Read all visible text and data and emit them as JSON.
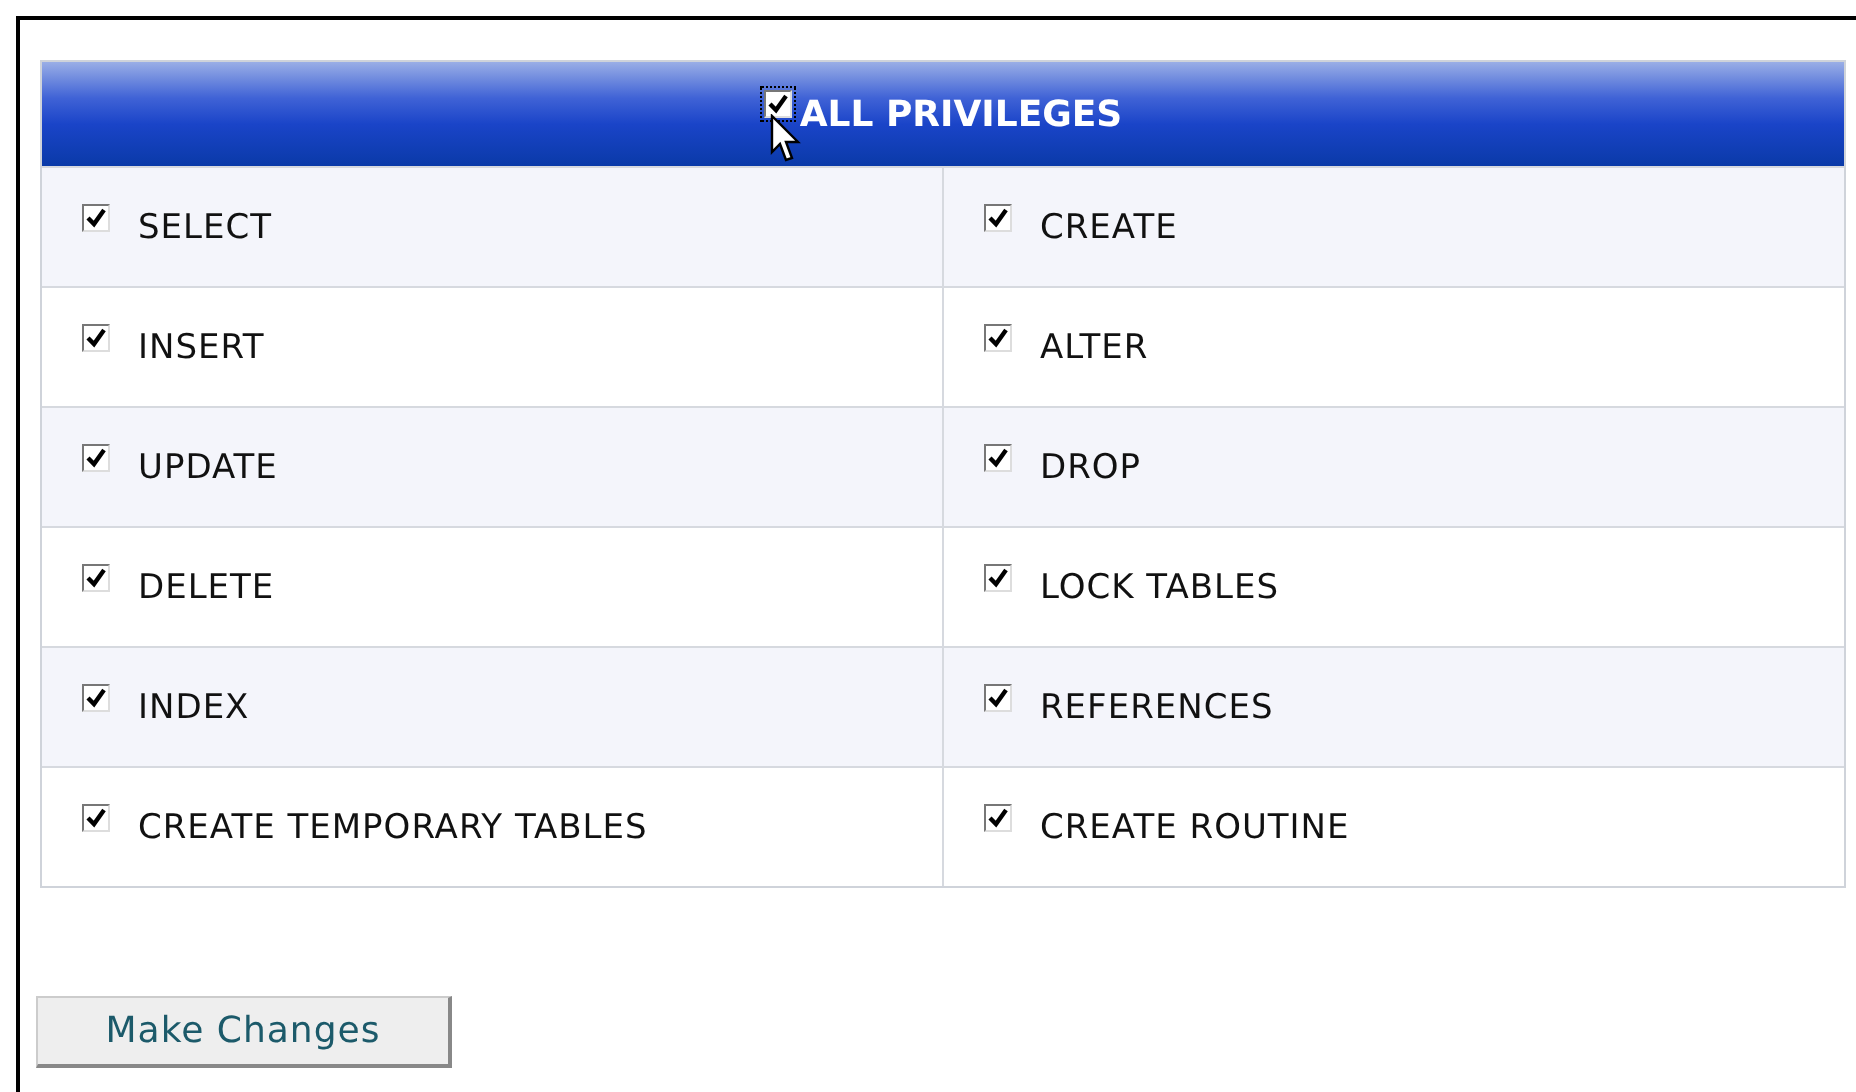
{
  "header": {
    "label": "ALL PRIVILEGES",
    "checked": true
  },
  "rows": [
    [
      {
        "label": "SELECT",
        "checked": true
      },
      {
        "label": "CREATE",
        "checked": true
      }
    ],
    [
      {
        "label": "INSERT",
        "checked": true
      },
      {
        "label": "ALTER",
        "checked": true
      }
    ],
    [
      {
        "label": "UPDATE",
        "checked": true
      },
      {
        "label": "DROP",
        "checked": true
      }
    ],
    [
      {
        "label": "DELETE",
        "checked": true
      },
      {
        "label": "LOCK TABLES",
        "checked": true
      }
    ],
    [
      {
        "label": "INDEX",
        "checked": true
      },
      {
        "label": "REFERENCES",
        "checked": true
      }
    ],
    [
      {
        "label": "CREATE TEMPORARY TABLES",
        "checked": true
      },
      {
        "label": "CREATE ROUTINE",
        "checked": true
      }
    ]
  ],
  "button": "Make Changes"
}
